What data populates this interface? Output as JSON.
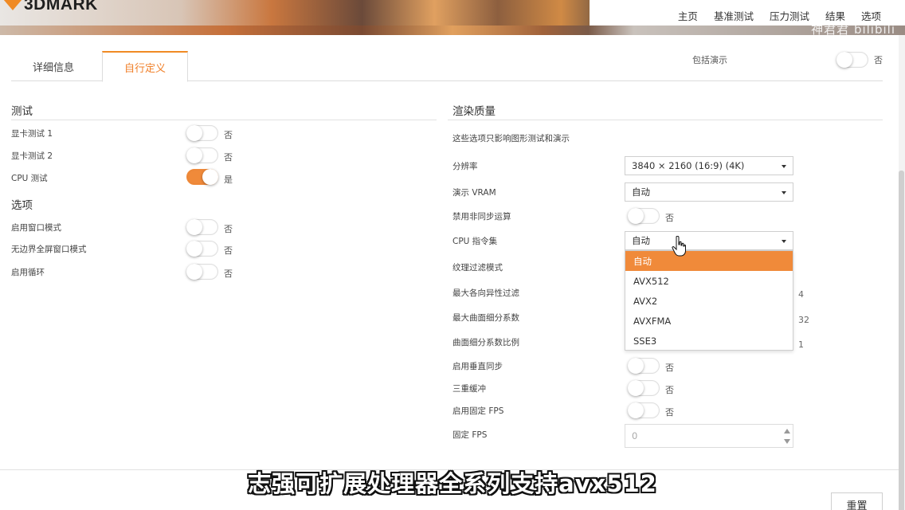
{
  "header": {
    "logo_text": "3DMARK",
    "nav": [
      "主页",
      "基准测试",
      "压力测试",
      "结果",
      "选项"
    ],
    "watermark": "神君君 bilibili"
  },
  "tabs": [
    {
      "label": "详细信息",
      "active": false
    },
    {
      "label": "自行定义",
      "active": true
    }
  ],
  "include_demo": {
    "label": "包括演示",
    "state": "否"
  },
  "test_section": {
    "title": "测试",
    "rows": [
      {
        "label": "显卡测试 1",
        "state": "否",
        "on": false
      },
      {
        "label": "显卡测试 2",
        "state": "否",
        "on": false
      },
      {
        "label": "CPU 测试",
        "state": "是",
        "on": true
      }
    ]
  },
  "options_section": {
    "title": "选项",
    "rows": [
      {
        "label": "启用窗口模式",
        "state": "否",
        "on": false
      },
      {
        "label": "无边界全屏窗口模式",
        "state": "否",
        "on": false
      },
      {
        "label": "启用循环",
        "state": "否",
        "on": false
      }
    ]
  },
  "render_section": {
    "title": "渲染质量",
    "note": "这些选项只影响图形测试和演示",
    "resolution": {
      "label": "分辨率",
      "value": "3840 × 2160 (16:9) (4K)"
    },
    "demo_vram": {
      "label": "演示 VRAM",
      "value": "自动"
    },
    "async_compute": {
      "label": "禁用非同步运算",
      "state": "否"
    },
    "cpu_instruction": {
      "label": "CPU 指令集",
      "value": "自动",
      "options": [
        "自动",
        "AVX512",
        "AVX2",
        "AVXFMA",
        "SSE3"
      ]
    },
    "texture_filter": {
      "label": "纹理过滤模式"
    },
    "max_anisotropy": {
      "label": "最大各向异性过滤",
      "value": "4"
    },
    "max_tessellation": {
      "label": "最大曲面细分系数",
      "value": "32"
    },
    "tessellation_scale": {
      "label": "曲面细分系数比例",
      "value": "1"
    },
    "vsync": {
      "label": "启用垂直同步",
      "state": "否"
    },
    "triple_buffer": {
      "label": "三重缓冲",
      "state": "否"
    },
    "fixed_fps_enable": {
      "label": "启用固定 FPS",
      "state": "否"
    },
    "fixed_fps": {
      "label": "固定 FPS",
      "value": "0"
    }
  },
  "reset_label": "重置",
  "subtitle": "志强可扩展处理器全系列支持avx512",
  "colors": {
    "accent": "#f08a3a",
    "text": "#333333",
    "border": "#dcdcdc"
  }
}
